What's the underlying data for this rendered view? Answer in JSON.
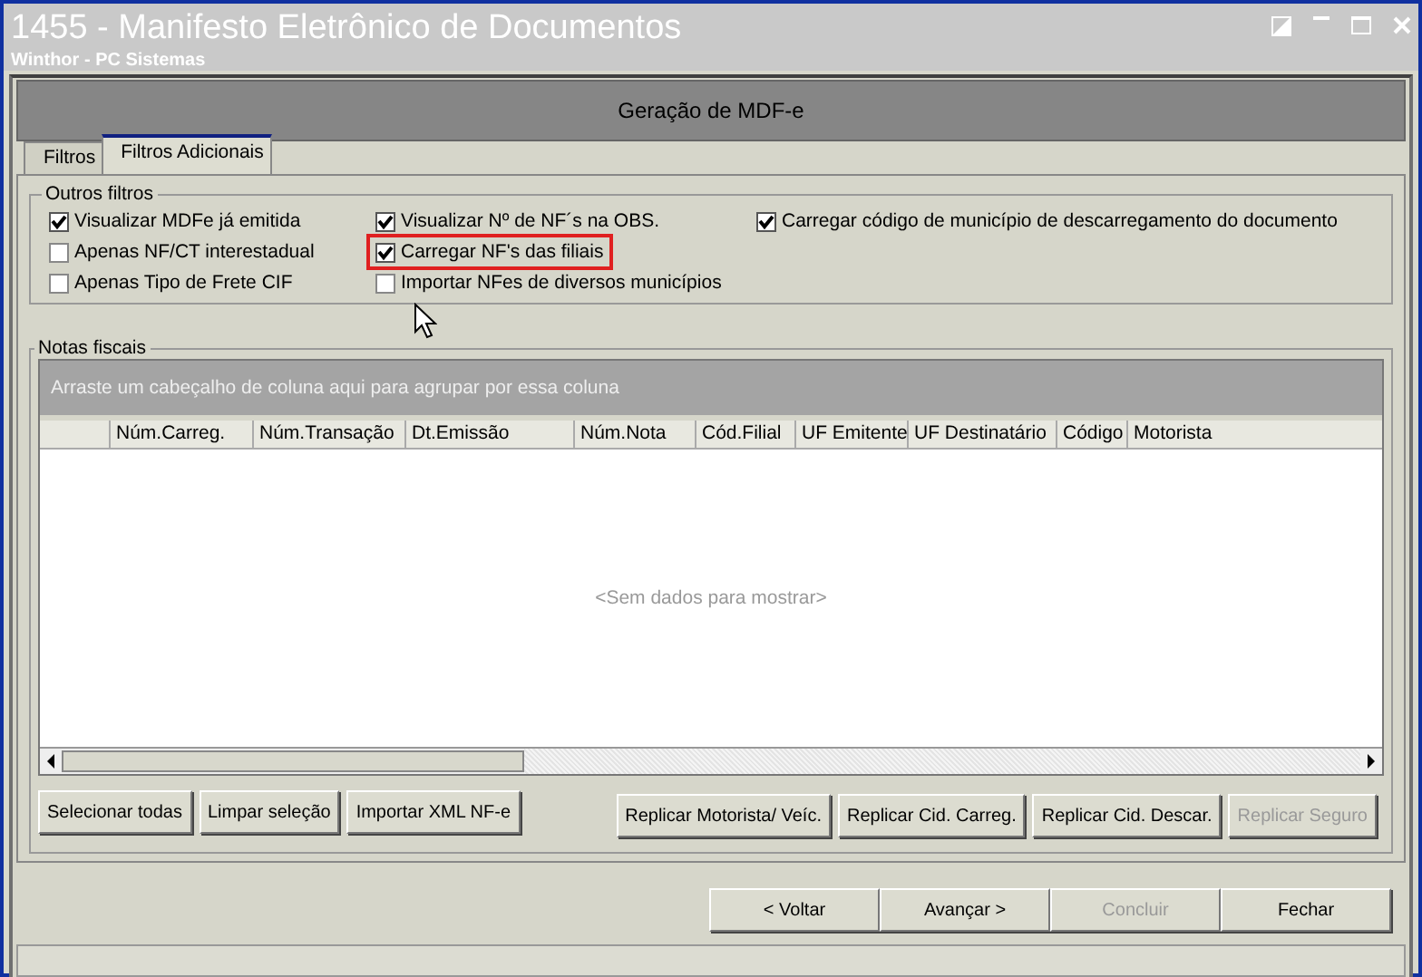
{
  "window": {
    "title": "1455 - Manifesto Eletrônico de Documentos",
    "subtitle": "Winthor - PC Sistemas"
  },
  "header": "Geração de MDF-e",
  "tabs": [
    {
      "label": "Filtros",
      "selected": false
    },
    {
      "label": "Filtros Adicionais",
      "selected": true
    }
  ],
  "outros_filtros": {
    "title": "Outros filtros",
    "columns": [
      [
        {
          "label": "Visualizar MDFe já emitida",
          "checked": true,
          "highlighted": false
        },
        {
          "label": "Apenas NF/CT interestadual",
          "checked": false,
          "highlighted": false
        },
        {
          "label": "Apenas Tipo de Frete CIF",
          "checked": false,
          "highlighted": false
        }
      ],
      [
        {
          "label": "Visualizar Nº de NF´s na OBS.",
          "checked": true,
          "highlighted": false
        },
        {
          "label": "Carregar NF's das filiais",
          "checked": true,
          "highlighted": true
        },
        {
          "label": "Importar NFes de diversos municípios",
          "checked": false,
          "highlighted": false
        }
      ],
      [
        {
          "label": "Carregar código de município de descarregamento do documento",
          "checked": true,
          "highlighted": false
        }
      ]
    ]
  },
  "notas_fiscais": {
    "title": "Notas fiscais",
    "group_hint": "Arraste um cabeçalho de coluna aqui para agrupar por essa coluna",
    "columns": [
      "Núm.Carreg.",
      "Núm.Transação",
      "Dt.Emissão",
      "Núm.Nota",
      "Cód.Filial",
      "UF Emitente",
      "UF Destinatário",
      "Código",
      "Motorista"
    ],
    "empty_text": "<Sem dados para mostrar>"
  },
  "grid_buttons": [
    {
      "label": "Selecionar todas",
      "disabled": false
    },
    {
      "label": "Limpar seleção",
      "disabled": false
    },
    {
      "label": "Importar XML NF-e",
      "disabled": false
    },
    {
      "label": "Replicar Motorista/ Veíc.",
      "disabled": false
    },
    {
      "label": "Replicar Cid. Carreg.",
      "disabled": false
    },
    {
      "label": "Replicar Cid. Descar.",
      "disabled": false
    },
    {
      "label": "Replicar Seguro",
      "disabled": true
    }
  ],
  "nav_buttons": [
    {
      "label": "< Voltar",
      "disabled": false
    },
    {
      "label": "Avançar >",
      "disabled": false
    },
    {
      "label": "Concluir",
      "disabled": true
    },
    {
      "label": "Fechar",
      "disabled": false
    }
  ]
}
